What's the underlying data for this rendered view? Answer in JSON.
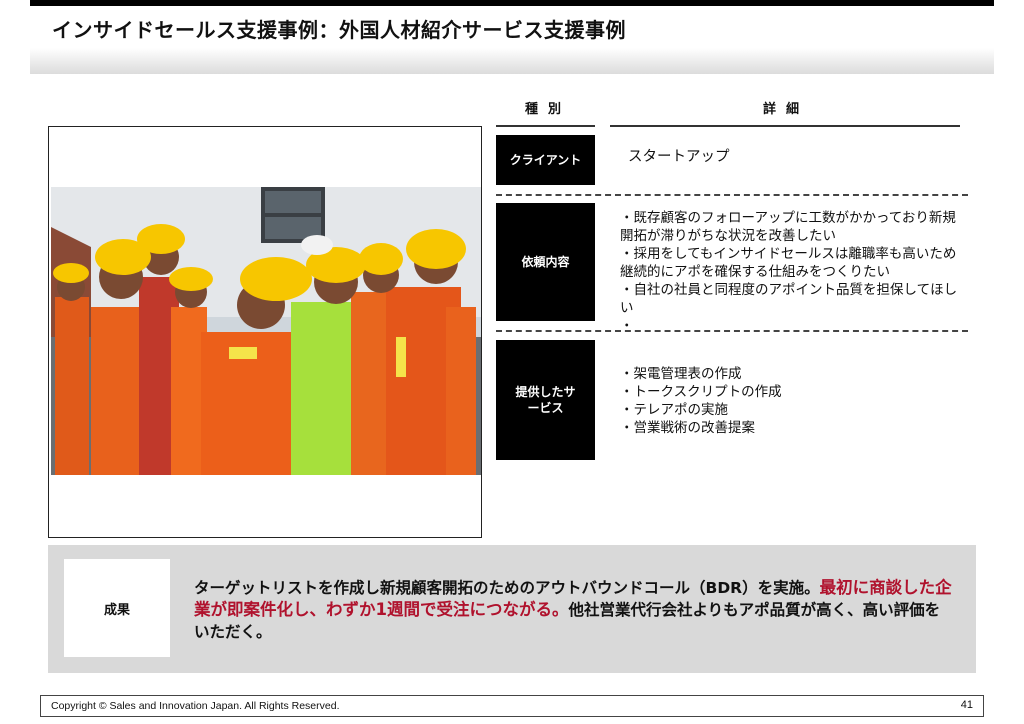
{
  "header": {
    "title": "インサイドセールス支援事例：外国人材紹介サービス支援事例"
  },
  "table": {
    "col_category": "種別",
    "col_detail": "詳細",
    "rows": [
      {
        "category": "クライアント",
        "details": [
          "スタートアップ"
        ]
      },
      {
        "category": "依頼内容",
        "details": [
          "・既存顧客のフォローアップに工数がかかっており新規開拓が滞りがちな状況を改善したい",
          "・採用をしてもインサイドセールスは離職率も高いため継続的にアポを確保する仕組みをつくりたい",
          "・自社の社員と同程度のアポイント品質を担保してほしい",
          "・"
        ]
      },
      {
        "category": "提供したサービス",
        "details": [
          "・架電管理表の作成",
          "・トークスクリプトの作成",
          "・テレアポの実施",
          "・営業戦術の改善提案"
        ]
      }
    ]
  },
  "result": {
    "label": "成果",
    "text_before": "ターゲットリストを作成し新規顧客開拓のためのアウトバウンドコール（BDR）を実施。",
    "text_highlight": "最初に商談した企業が即案件化し、わずか1週間で受注につながる。",
    "text_after": "他社営業代行会社よりもアポ品質が高く、高い評価をいただく。",
    "highlight_color": "#b0122d"
  },
  "footer": {
    "copyright": "Copyright © Sales and Innovation Japan. All Rights Reserved.",
    "page_number": "41"
  }
}
